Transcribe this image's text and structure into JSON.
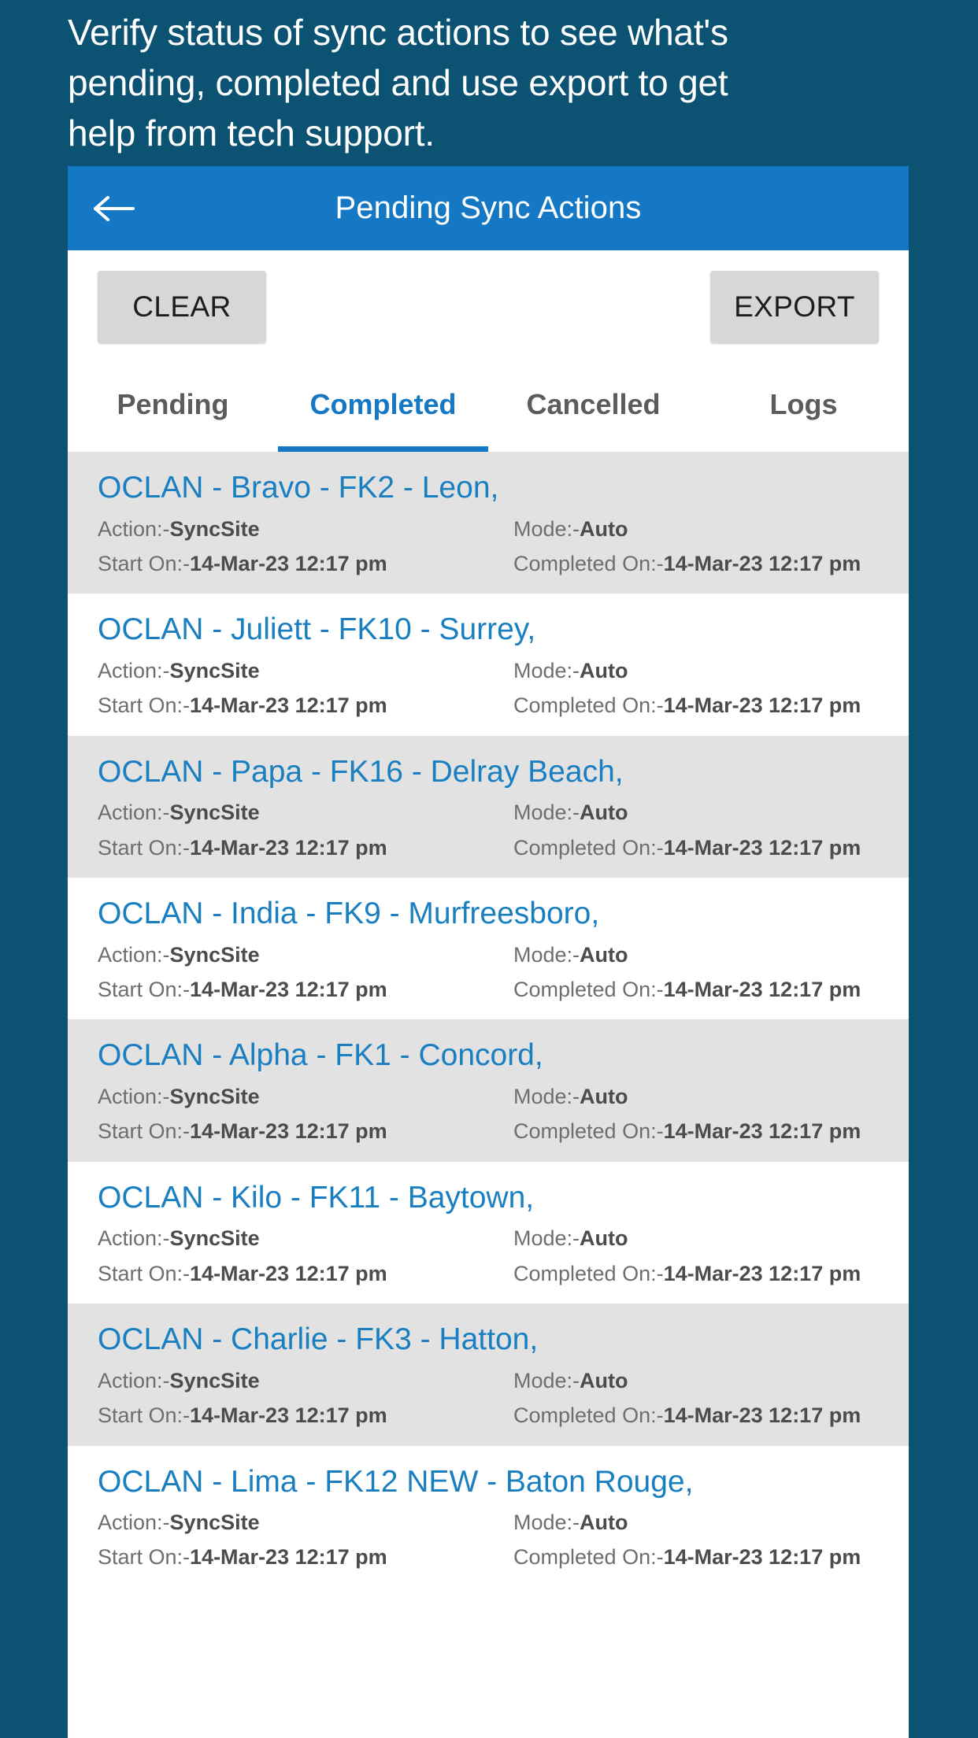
{
  "caption": {
    "lines": [
      "Verify status of sync actions to see what's",
      "pending, completed and use export to get",
      "help from tech support."
    ]
  },
  "colors": {
    "page_background": "#0b5273",
    "appbar": "#1478c4",
    "accent": "#1478c4",
    "link": "#1a7fc1",
    "button_face": "#d7d7d7",
    "row_alt": "#e2e2e2"
  },
  "appbar": {
    "back_icon": "arrow-left-icon",
    "title": "Pending Sync Actions"
  },
  "toolbar": {
    "clear_label": "CLEAR",
    "export_label": "EXPORT"
  },
  "tabs": {
    "active": "Completed",
    "items": [
      {
        "label": "Pending"
      },
      {
        "label": "Completed"
      },
      {
        "label": "Cancelled"
      },
      {
        "label": "Logs"
      }
    ]
  },
  "labels": {
    "action": "Action:-",
    "mode": "Mode:-",
    "start_on": "Start On:-",
    "completed_on": "Completed On:-"
  },
  "list": {
    "rows": [
      {
        "title": "OCLAN - Bravo - FK2 - Leon,",
        "action": "SyncSite",
        "mode": "Auto",
        "start_on": "14-Mar-23 12:17 pm",
        "completed_on": "14-Mar-23 12:17 pm"
      },
      {
        "title": "OCLAN - Juliett - FK10 - Surrey,",
        "action": "SyncSite",
        "mode": "Auto",
        "start_on": "14-Mar-23 12:17 pm",
        "completed_on": "14-Mar-23 12:17 pm"
      },
      {
        "title": "OCLAN - Papa - FK16 - Delray Beach,",
        "action": "SyncSite",
        "mode": "Auto",
        "start_on": "14-Mar-23 12:17 pm",
        "completed_on": "14-Mar-23 12:17 pm"
      },
      {
        "title": "OCLAN - India - FK9 - Murfreesboro,",
        "action": "SyncSite",
        "mode": "Auto",
        "start_on": "14-Mar-23 12:17 pm",
        "completed_on": "14-Mar-23 12:17 pm"
      },
      {
        "title": "OCLAN - Alpha - FK1 - Concord,",
        "action": "SyncSite",
        "mode": "Auto",
        "start_on": "14-Mar-23 12:17 pm",
        "completed_on": "14-Mar-23 12:17 pm"
      },
      {
        "title": "OCLAN - Kilo - FK11 - Baytown,",
        "action": "SyncSite",
        "mode": "Auto",
        "start_on": "14-Mar-23 12:17 pm",
        "completed_on": "14-Mar-23 12:17 pm"
      },
      {
        "title": "OCLAN - Charlie - FK3 - Hatton,",
        "action": "SyncSite",
        "mode": "Auto",
        "start_on": "14-Mar-23 12:17 pm",
        "completed_on": "14-Mar-23 12:17 pm"
      },
      {
        "title": "OCLAN - Lima - FK12 NEW - Baton Rouge,",
        "action": "SyncSite",
        "mode": "Auto",
        "start_on": "14-Mar-23 12:17 pm",
        "completed_on": "14-Mar-23 12:17 pm"
      }
    ]
  }
}
